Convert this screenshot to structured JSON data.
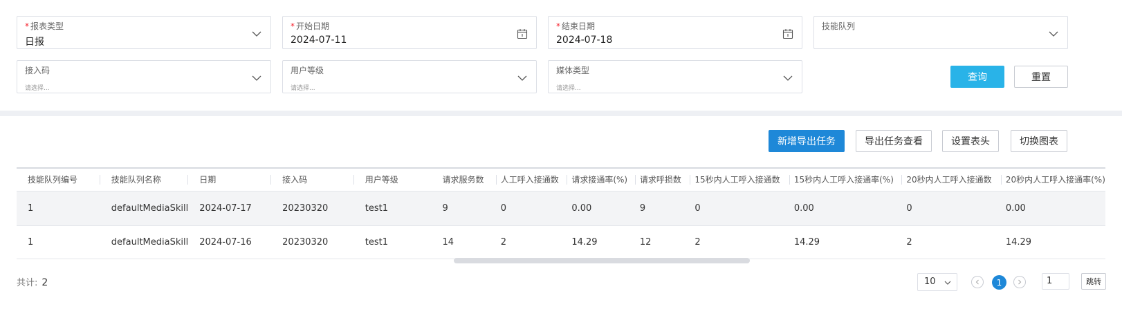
{
  "filters": {
    "report_type": {
      "label": "报表类型",
      "value": "日报",
      "required": true
    },
    "start_date": {
      "label": "开始日期",
      "value": "2024-07-11",
      "required": true
    },
    "end_date": {
      "label": "结束日期",
      "value": "2024-07-18",
      "required": true
    },
    "skill_queue": {
      "label": "技能队列",
      "value": ""
    },
    "access_code": {
      "label": "接入码",
      "placeholder": "请选择..."
    },
    "user_level": {
      "label": "用户等级",
      "placeholder": "请选择..."
    },
    "media_type": {
      "label": "媒体类型",
      "placeholder": "请选择..."
    },
    "required_mark": "*",
    "query_label": "查询",
    "reset_label": "重置"
  },
  "toolbar": {
    "new_export_label": "新增导出任务",
    "view_export_label": "导出任务查看",
    "set_header_label": "设置表头",
    "switch_chart_label": "切换图表"
  },
  "table": {
    "columns": [
      "技能队列编号",
      "技能队列名称",
      "日期",
      "接入码",
      "用户等级",
      "请求服务数",
      "人工呼入接通数",
      "请求接通率(%)",
      "请求呼损数",
      "15秒内人工呼入接通数",
      "15秒内人工呼入接通率(%)",
      "20秒内人工呼入接通数",
      "20秒内人工呼入接通率(%)"
    ],
    "rows": [
      [
        "1",
        "defaultMediaSkill",
        "2024-07-17",
        "20230320",
        "test1",
        "9",
        "0",
        "0.00",
        "9",
        "0",
        "0.00",
        "0",
        "0.00"
      ],
      [
        "1",
        "defaultMediaSkill",
        "2024-07-16",
        "20230320",
        "test1",
        "14",
        "2",
        "14.29",
        "12",
        "2",
        "14.29",
        "2",
        "14.29"
      ]
    ]
  },
  "footer": {
    "total_label": "共计:",
    "total_value": "2",
    "page_size": "10",
    "current_page": "1",
    "jump_value": "1",
    "jump_label": "跳转"
  },
  "colors": {
    "primary": "#1e88d8",
    "query": "#29b3e8",
    "required": "#f5222d"
  },
  "icons": {
    "dropdown": "chevron-down-icon",
    "date": "calendar-icon",
    "prev": "chevron-left-icon",
    "next": "chevron-right-icon"
  }
}
